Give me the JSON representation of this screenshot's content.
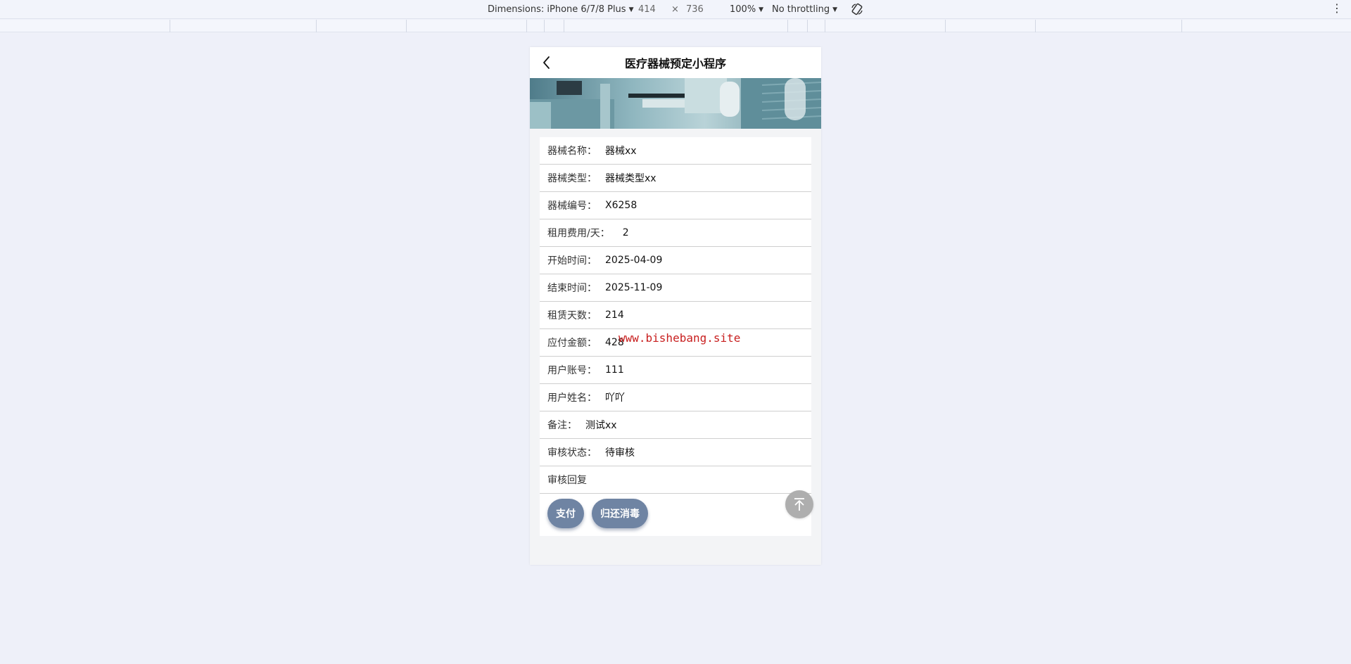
{
  "devtools": {
    "dimensions_label": "Dimensions: iPhone 6/7/8 Plus",
    "width": "414",
    "times": "×",
    "height": "736",
    "zoom": "100%",
    "throttling": "No throttling"
  },
  "app": {
    "title": "医疗器械预定小程序"
  },
  "fields": [
    {
      "label": "器械名称：",
      "value": "器械xx"
    },
    {
      "label": "器械类型：",
      "value": "器械类型xx"
    },
    {
      "label": "器械编号：",
      "value": "X6258"
    },
    {
      "label": "租用费用/天：",
      "value": "2"
    },
    {
      "label": "开始时间：",
      "value": "2025-04-09"
    },
    {
      "label": "结束时间：",
      "value": "2025-11-09"
    },
    {
      "label": "租赁天数：",
      "value": "214"
    },
    {
      "label": "应付金额：",
      "value": "428"
    },
    {
      "label": "用户账号：",
      "value": "111"
    },
    {
      "label": "用户姓名：",
      "value": "吖吖"
    },
    {
      "label": "备注：",
      "value": "测试xx"
    },
    {
      "label": "审核状态：",
      "value": "待审核"
    },
    {
      "label": "审核回复",
      "value": ""
    }
  ],
  "actions": {
    "pay_label": "支付",
    "return_label": "归还消毒"
  },
  "watermark": "www.bishebang.site",
  "colors": {
    "background": "#eef0f9",
    "button": "#6f84a3",
    "watermark": "#c81e1e",
    "totop": "#aeaeae"
  },
  "icons": [
    "chevron-down-icon",
    "rotate-icon",
    "more-vertical-icon",
    "back-arrow-icon",
    "arrow-up-to-top-icon"
  ]
}
